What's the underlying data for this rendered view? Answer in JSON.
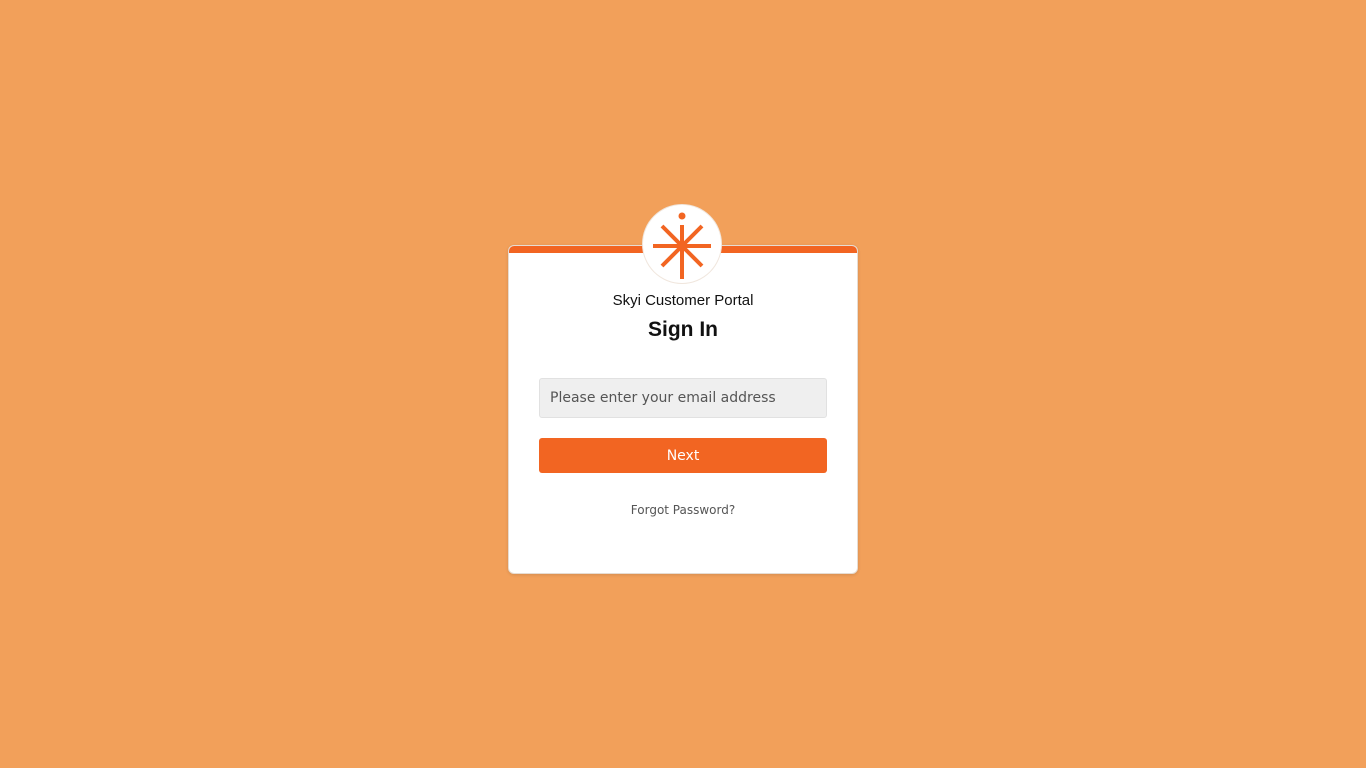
{
  "app": {
    "portal_name": "Skyi Customer Portal",
    "title": "Sign In"
  },
  "logo": {
    "icon": "asterisk-logo-icon",
    "color": "#F26522"
  },
  "form": {
    "email_placeholder": "Please enter your email address",
    "email_value": "",
    "next_label": "Next",
    "forgot_label": "Forgot Password?"
  },
  "colors": {
    "background": "#F2A05A",
    "accent": "#F26522",
    "card": "#FFFFFF"
  }
}
